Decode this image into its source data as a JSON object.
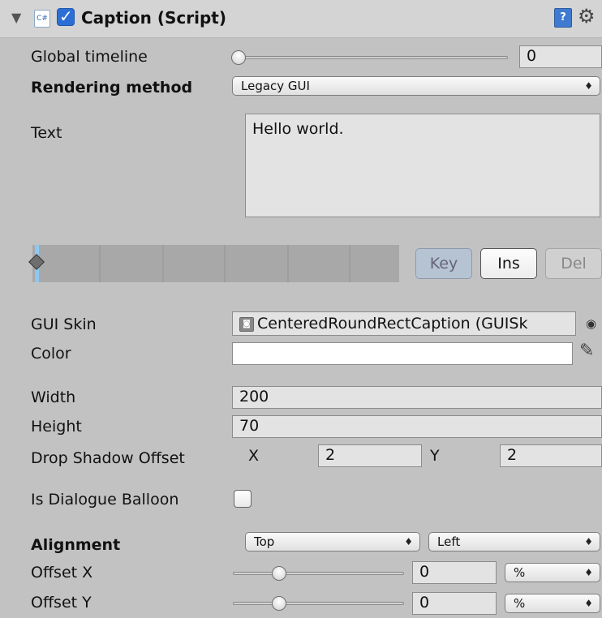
{
  "component": {
    "title": "Caption (Script)",
    "enabled": true,
    "cs_badge": "C#",
    "help_icon": "?"
  },
  "global_timeline": {
    "label": "Global timeline",
    "value": "0",
    "slider_fraction": 0.0
  },
  "rendering_method": {
    "label": "Rendering method",
    "value": "Legacy GUI"
  },
  "text": {
    "label": "Text",
    "value": "Hello world."
  },
  "keyframes": {
    "key_label": "Key",
    "ins_label": "Ins",
    "del_label": "Del"
  },
  "gui_skin": {
    "label": "GUI Skin",
    "value": "CenteredRoundRectCaption (GUISk"
  },
  "color": {
    "label": "Color",
    "value": "#ffffff"
  },
  "width": {
    "label": "Width",
    "value": "200"
  },
  "height": {
    "label": "Height",
    "value": "70"
  },
  "drop_shadow": {
    "label": "Drop Shadow Offset",
    "x_label": "X",
    "x_value": "2",
    "y_label": "Y",
    "y_value": "2"
  },
  "dialogue_balloon": {
    "label": "Is Dialogue Balloon",
    "checked": false
  },
  "alignment": {
    "label": "Alignment",
    "vertical": "Top",
    "horizontal": "Left"
  },
  "offset_x": {
    "label": "Offset X",
    "value": "0",
    "unit": "%",
    "slider_fraction": 0.27
  },
  "offset_y": {
    "label": "Offset Y",
    "value": "0",
    "unit": "%",
    "slider_fraction": 0.27
  },
  "colors": {
    "panel_bg": "#c2c2c2",
    "header_bg": "#d4d4d4",
    "keyframe_marker": "#8ec8f0",
    "checkbox_blue": "#2b6fd6"
  }
}
